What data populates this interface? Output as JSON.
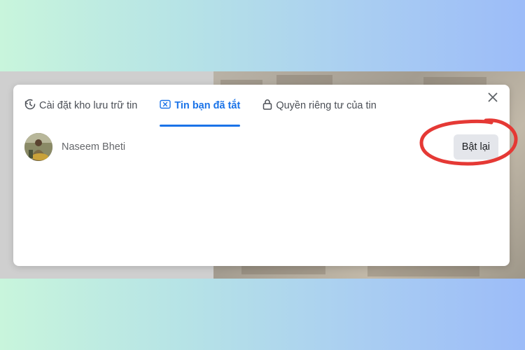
{
  "tabs": [
    {
      "label": "Cài đặt kho lưu trữ tin",
      "icon": "clock-archive-icon",
      "active": false
    },
    {
      "label": "Tin bạn đã tắt",
      "icon": "muted-x-icon",
      "active": true
    },
    {
      "label": "Quyền riêng tư của tin",
      "icon": "lock-icon",
      "active": false
    }
  ],
  "muted_list": [
    {
      "name": "Naseem Bheti",
      "action_label": "Bật lại"
    }
  ],
  "colors": {
    "accent": "#1a73e8",
    "annotation": "#e53935",
    "button_bg": "#e4e6eb"
  }
}
